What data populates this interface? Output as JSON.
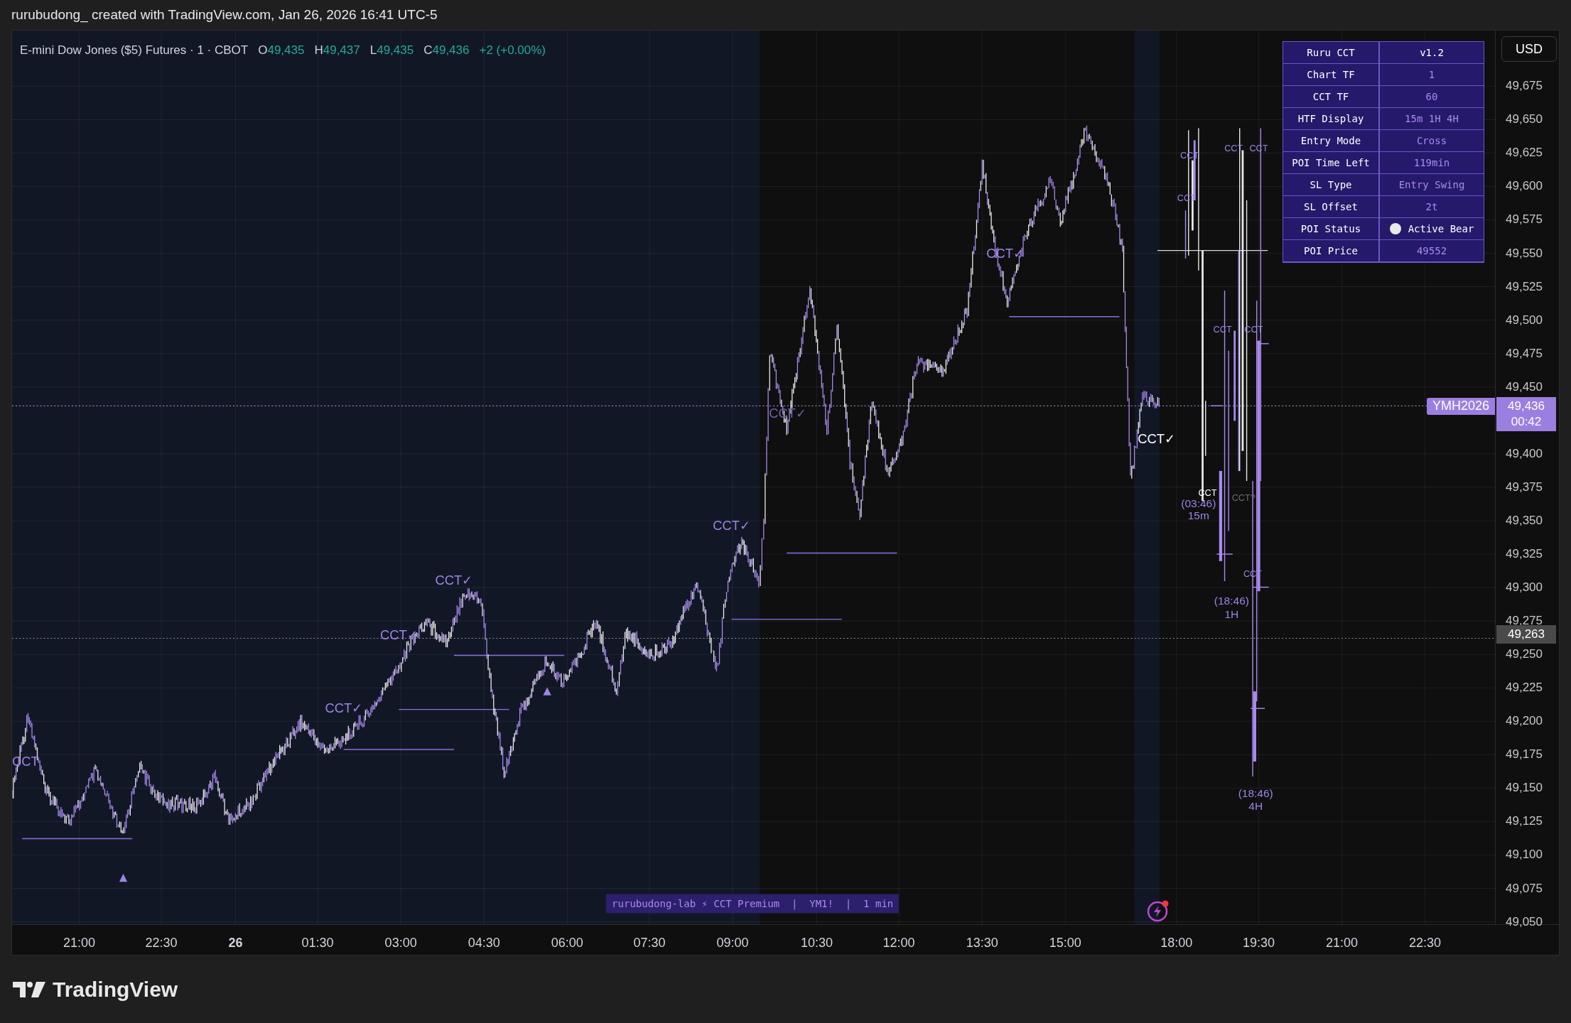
{
  "header": {
    "attribution": "rurubudong_ created with TradingView.com, Jan 26, 2026 16:41 UTC-5"
  },
  "legend": {
    "symbol": "E-mini Dow Jones ($5) Futures · 1 · CBOT",
    "ohlc": [
      {
        "label": "O",
        "value": "49,435"
      },
      {
        "label": "H",
        "value": "49,437"
      },
      {
        "label": "L",
        "value": "49,435"
      },
      {
        "label": "C",
        "value": "49,436"
      }
    ],
    "change": "+2 (+0.00%)"
  },
  "indicator_table": {
    "rows": [
      {
        "label": "Ruru CCT",
        "value": "v1.2",
        "kind": "title"
      },
      {
        "label": "Chart TF",
        "value": "1",
        "kind": "setting"
      },
      {
        "label": "CCT TF",
        "value": "60",
        "kind": "setting"
      },
      {
        "label": "HTF Display",
        "value": "15m 1H 4H",
        "kind": "setting"
      },
      {
        "label": "Entry Mode",
        "value": "Cross",
        "kind": "setting"
      },
      {
        "label": "POI Time Left",
        "value": "119min",
        "kind": "setting"
      },
      {
        "label": "SL Type",
        "value": "Entry Swing",
        "kind": "setting"
      },
      {
        "label": "SL Offset",
        "value": "2t",
        "kind": "setting"
      },
      {
        "label": "POI Status",
        "value": "Active Bear",
        "kind": "status"
      },
      {
        "label": "POI Price",
        "value": "49552",
        "kind": "setting"
      }
    ]
  },
  "chart_labels": [
    {
      "text": "CCT",
      "color": "#9d84e8"
    },
    {
      "text": "CCT✓",
      "color": "#9d84e8"
    },
    {
      "text": "CCT✓",
      "color": "#9d84e8"
    },
    {
      "text": "CCT✓",
      "color": "#9d84e8"
    },
    {
      "text": "CCT✓",
      "color": "#9d84e8"
    },
    {
      "text": "CCT✓",
      "color": "#6f5fa8"
    },
    {
      "text": "CCT✓",
      "color": "#9d84e8"
    },
    {
      "text": "CCT✓",
      "color": "#ffffff"
    },
    {
      "text": "CCT",
      "color": "#9d84e8"
    },
    {
      "text": "CCT",
      "color": "#9d84e8"
    },
    {
      "text": "CCT",
      "color": "#9d84e8"
    },
    {
      "text": "CCT",
      "color": "#9d84e8"
    },
    {
      "text": "CCT",
      "color": "#9d84e8"
    },
    {
      "text": "CCT",
      "color": "#9d84e8"
    },
    {
      "text": "CCT",
      "color": "#ffffff"
    },
    {
      "text": "CCT?",
      "color": "#6b6b6b"
    },
    {
      "text": "CCT",
      "color": "#9d84e8"
    },
    {
      "text": "(03:46)",
      "color": "#9d84e8"
    },
    {
      "text": "15m",
      "color": "#9d84e8"
    },
    {
      "text": "(18:46)",
      "color": "#9d84e8"
    },
    {
      "text": "1H",
      "color": "#9d84e8"
    },
    {
      "text": "(18:46)",
      "color": "#9d84e8"
    },
    {
      "text": "4H",
      "color": "#9d84e8"
    }
  ],
  "banner": "rurubudong-lab ⚡ CCT Premium  |  YM1!  |  1 min",
  "price_axis": {
    "currency": "USD",
    "ticks": [
      "49,675",
      "49,650",
      "49,625",
      "49,600",
      "49,575",
      "49,550",
      "49,525",
      "49,500",
      "49,475",
      "49,450",
      "49,400",
      "49,375",
      "49,350",
      "49,325",
      "49,300",
      "49,275",
      "49,250",
      "49,225",
      "49,200",
      "49,175",
      "49,150",
      "49,125",
      "49,100",
      "49,075",
      "49,050"
    ],
    "last_price": {
      "symbol": "YMH2026",
      "price": "49,436",
      "countdown": "00:42"
    },
    "marker_price": "49,263"
  },
  "time_axis": {
    "labels": [
      {
        "text": "21:00",
        "bold": false
      },
      {
        "text": "22:30",
        "bold": false
      },
      {
        "text": "26",
        "bold": true
      },
      {
        "text": "01:30",
        "bold": false
      },
      {
        "text": "03:00",
        "bold": false
      },
      {
        "text": "04:30",
        "bold": false
      },
      {
        "text": "06:00",
        "bold": false
      },
      {
        "text": "07:30",
        "bold": false
      },
      {
        "text": "09:00",
        "bold": false
      },
      {
        "text": "10:30",
        "bold": false
      },
      {
        "text": "12:00",
        "bold": false
      },
      {
        "text": "13:30",
        "bold": false
      },
      {
        "text": "15:00",
        "bold": false
      },
      {
        "text": "18:00",
        "bold": false
      },
      {
        "text": "19:30",
        "bold": false
      },
      {
        "text": "21:00",
        "bold": false
      },
      {
        "text": "22:30",
        "bold": false
      }
    ]
  },
  "footer": {
    "brand": "TradingView"
  }
}
